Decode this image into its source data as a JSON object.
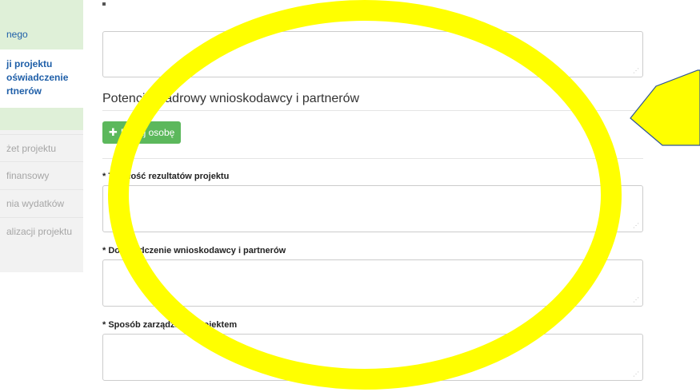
{
  "sidebar": {
    "top_line1": "",
    "top_line2": "nego",
    "active_lines": [
      "ji projektu",
      "oświadczenie",
      "rtnerów"
    ],
    "items": [
      "żet projektu",
      "finansowy",
      "nia wydatków",
      "alizacji projektu"
    ]
  },
  "main": {
    "section_title": "Potencjał kadrowy wnioskodawcy i partnerów",
    "add_person_button": "Dodaj osobę",
    "fields": [
      {
        "label": "* Trwałość rezultatów projektu"
      },
      {
        "label": "* Doświadczenie wnioskodawcy i partnerów"
      },
      {
        "label": "* Sposób zarządzania projektem"
      }
    ]
  },
  "overlays": {
    "ellipse_color": "#ffff00",
    "pentagon_fill": "#ffff00",
    "pentagon_stroke": "#2f5597"
  }
}
